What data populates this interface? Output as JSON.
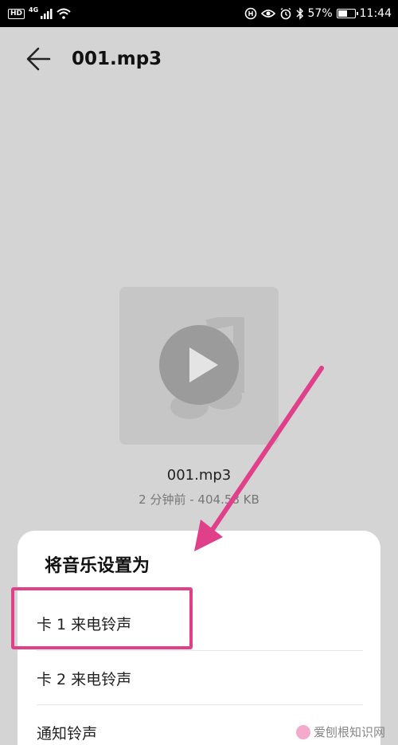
{
  "status_bar": {
    "hd": "HD",
    "network": "4G",
    "battery": "57%",
    "battery_level": 0.57,
    "time": "11:44"
  },
  "header": {
    "title": "001.mp3"
  },
  "file": {
    "name": "001.mp3",
    "meta": "2 分钟前 - 404.58 KB"
  },
  "sheet": {
    "title": "将音乐设置为",
    "items": [
      {
        "label": "卡 1 来电铃声"
      },
      {
        "label": "卡 2 来电铃声"
      },
      {
        "label": "通知铃声"
      }
    ]
  },
  "watermark": {
    "text": "爱刨根知识网"
  },
  "colors": {
    "annotation": "#e0408a",
    "overlay": "#d4d4d4",
    "sheet": "#ffffff"
  },
  "icons": {
    "back": "arrow-left-icon",
    "play": "play-icon",
    "music": "music-note-icon"
  }
}
